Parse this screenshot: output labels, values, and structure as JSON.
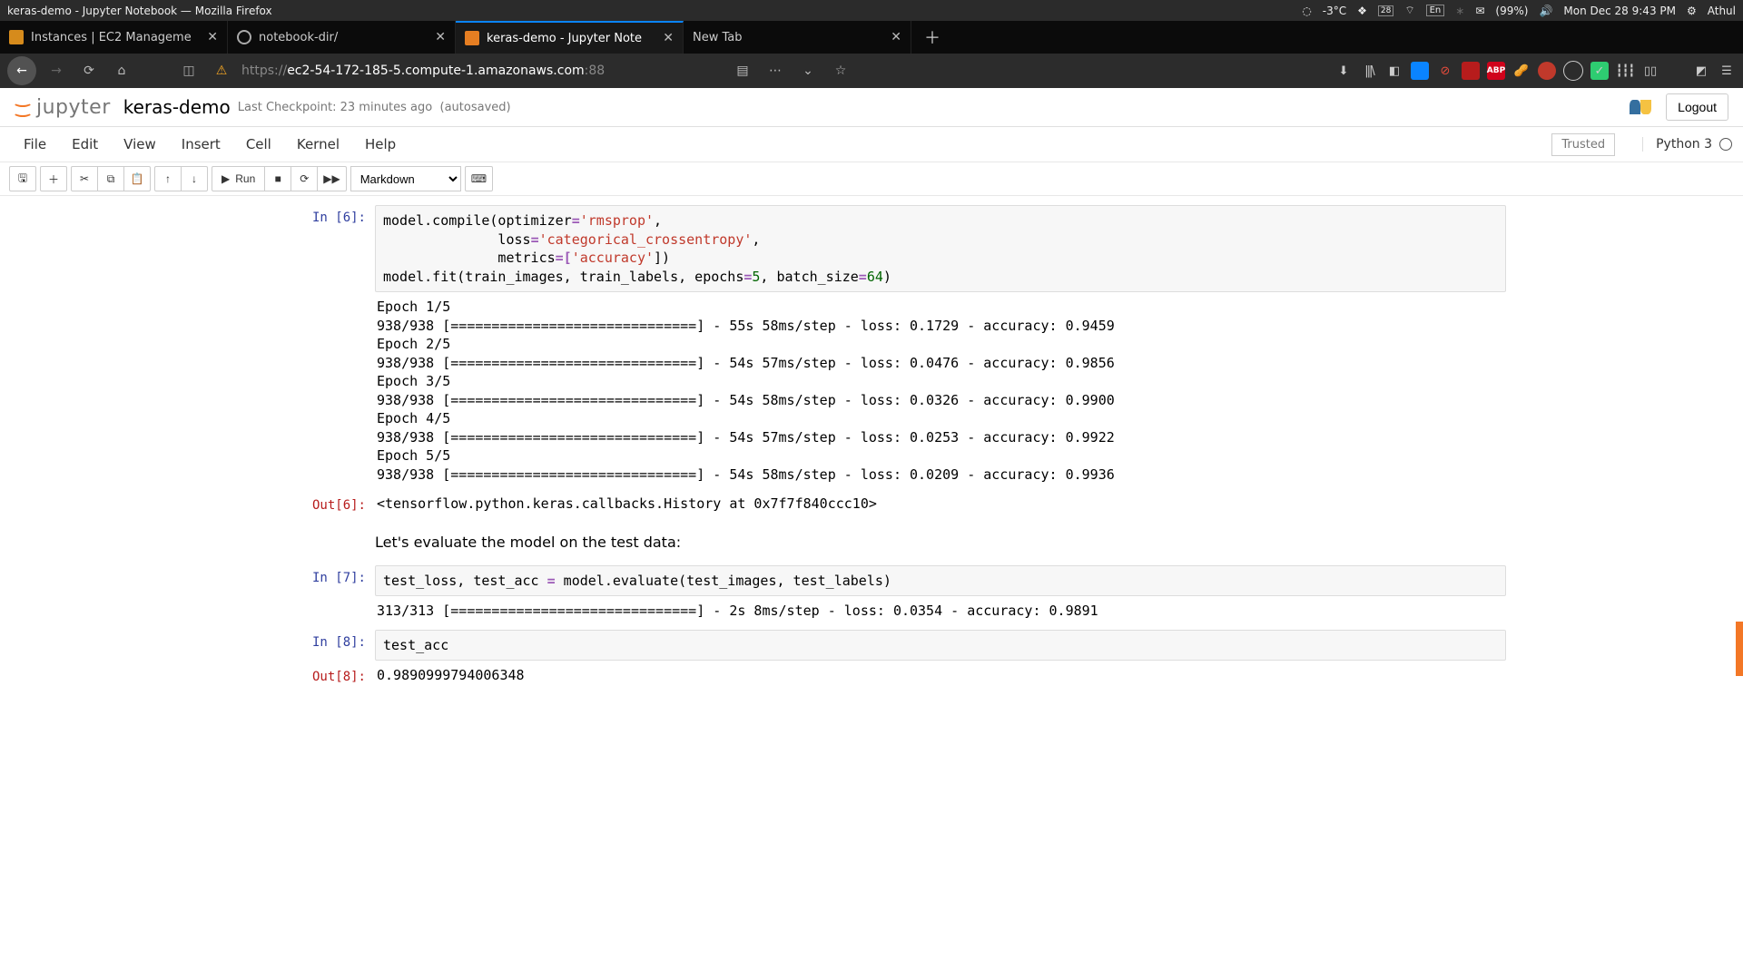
{
  "os": {
    "title": "keras-demo - Jupyter Notebook — Mozilla Firefox",
    "weather": "-3°C",
    "calendar_day": "28",
    "lang": "En",
    "battery": "(99%)",
    "clock": "Mon Dec 28  9:43 PM",
    "user": "Athul"
  },
  "tabs": [
    {
      "label": "Instances | EC2 Manageme",
      "active": false
    },
    {
      "label": "notebook-dir/",
      "active": false
    },
    {
      "label": "keras-demo - Jupyter Note",
      "active": true
    },
    {
      "label": "New Tab",
      "active": false
    }
  ],
  "url": {
    "scheme": "https://",
    "host": "ec2-54-172-185-5.compute-1.amazonaws.com",
    "port": ":88"
  },
  "toolbar_ext": {
    "abp": "ABP"
  },
  "jupyter": {
    "brand": "jupyter",
    "nbname": "keras-demo",
    "checkpoint": "Last Checkpoint: 23 minutes ago",
    "autosave": "(autosaved)",
    "logout": "Logout",
    "menus": [
      "File",
      "Edit",
      "View",
      "Insert",
      "Cell",
      "Kernel",
      "Help"
    ],
    "trusted": "Trusted",
    "kernel": "Python 3",
    "run_label": "Run",
    "celltype": "Markdown"
  },
  "cells": {
    "in6_prompt": "In [6]:",
    "out6_prompt": "Out[6]:",
    "in7_prompt": "In [7]:",
    "in8_prompt": "In [8]:",
    "out8_prompt": "Out[8]:",
    "c6_l1a": "model.compile(optimizer",
    "c6_l1b": "'rmsprop'",
    "c6_l1c": ",",
    "c6_l2a": "              loss",
    "c6_l2b": "'categorical_crossentropy'",
    "c6_l2c": ",",
    "c6_l3a": "              metrics",
    "c6_l3b": "=[",
    "c6_l3c": "'accuracy'",
    "c6_l3d": "])",
    "c6_l4a": "model.fit(train_images, train_labels, epochs",
    "c6_l4b": "5",
    "c6_l4c": ", batch_size",
    "c6_l4d": "64",
    "c6_l4e": ")",
    "stdout6": "Epoch 1/5\n938/938 [==============================] - 55s 58ms/step - loss: 0.1729 - accuracy: 0.9459\nEpoch 2/5\n938/938 [==============================] - 54s 57ms/step - loss: 0.0476 - accuracy: 0.9856\nEpoch 3/5\n938/938 [==============================] - 54s 58ms/step - loss: 0.0326 - accuracy: 0.9900\nEpoch 4/5\n938/938 [==============================] - 54s 57ms/step - loss: 0.0253 - accuracy: 0.9922\nEpoch 5/5\n938/938 [==============================] - 54s 58ms/step - loss: 0.0209 - accuracy: 0.9936",
    "out6_text": "<tensorflow.python.keras.callbacks.History at 0x7f7f840ccc10>",
    "md_text": "Let's evaluate the model on the test data:",
    "c7_l1a": "test_loss, test_acc ",
    "c7_l1b": " model.evaluate(test_images, test_labels)",
    "stdout7": "313/313 [==============================] - 2s 8ms/step - loss: 0.0354 - accuracy: 0.9891",
    "c8_code": "test_acc",
    "out8_text": "0.9890999794006348"
  }
}
